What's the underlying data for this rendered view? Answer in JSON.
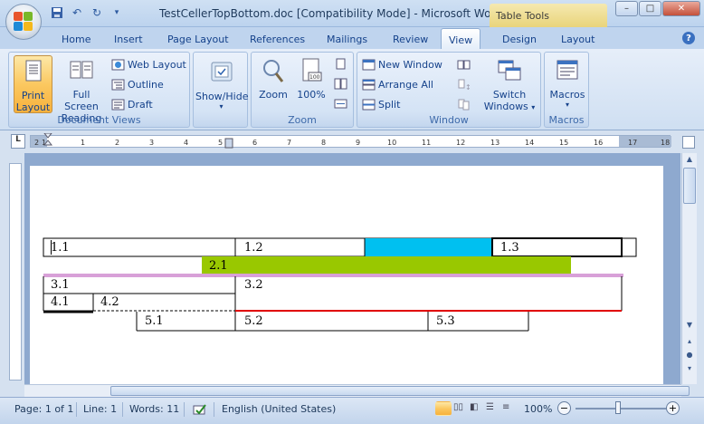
{
  "window": {
    "title": "TestCellerTopBottom.doc [Compatibility Mode] - Microsoft Word",
    "context_tab": "Table Tools",
    "minimize": "–",
    "maximize": "□",
    "close": "✕"
  },
  "tabs": [
    "Home",
    "Insert",
    "Page Layout",
    "References",
    "Mailings",
    "Review",
    "View",
    "Design",
    "Layout"
  ],
  "active_tab": "View",
  "ribbon": {
    "document_views": {
      "label": "Document Views",
      "print_layout_line1": "Print",
      "print_layout_line2": "Layout",
      "full_screen_line1": "Full Screen",
      "full_screen_line2": "Reading",
      "web_layout": "Web Layout",
      "outline": "Outline",
      "draft": "Draft"
    },
    "show_hide": {
      "label": "Show/Hide"
    },
    "zoom": {
      "label": "Zoom",
      "zoom_btn": "Zoom",
      "hundred": "100%"
    },
    "window": {
      "label": "Window",
      "new_window": "New Window",
      "arrange_all": "Arrange All",
      "split": "Split",
      "switch_windows_line1": "Switch",
      "switch_windows_line2": "Windows"
    },
    "macros": {
      "label": "Macros",
      "btn": "Macros"
    }
  },
  "ruler_numbers": [
    "2",
    "1",
    "1",
    "2",
    "3",
    "4",
    "5",
    "6",
    "7",
    "8",
    "9",
    "10",
    "11",
    "12",
    "13",
    "14",
    "15",
    "16",
    "17",
    "18"
  ],
  "table": {
    "row1": [
      "1.1",
      "1.2",
      "1.3"
    ],
    "row2": [
      "2.1"
    ],
    "row3": [
      "3.1",
      "3.2"
    ],
    "row4": [
      "4.1",
      "4.2"
    ],
    "row5": [
      "5.1",
      "5.2",
      "5.3"
    ],
    "colors": {
      "cyan": "#00c0f0",
      "green": "#99c800",
      "red": "#e00000",
      "magenta": "#b040b0"
    }
  },
  "status": {
    "page": "Page: 1 of 1",
    "line": "Line: 1",
    "words": "Words: 11",
    "language": "English (United States)",
    "zoom": "100%",
    "zoom_minus": "−",
    "zoom_plus": "+"
  }
}
